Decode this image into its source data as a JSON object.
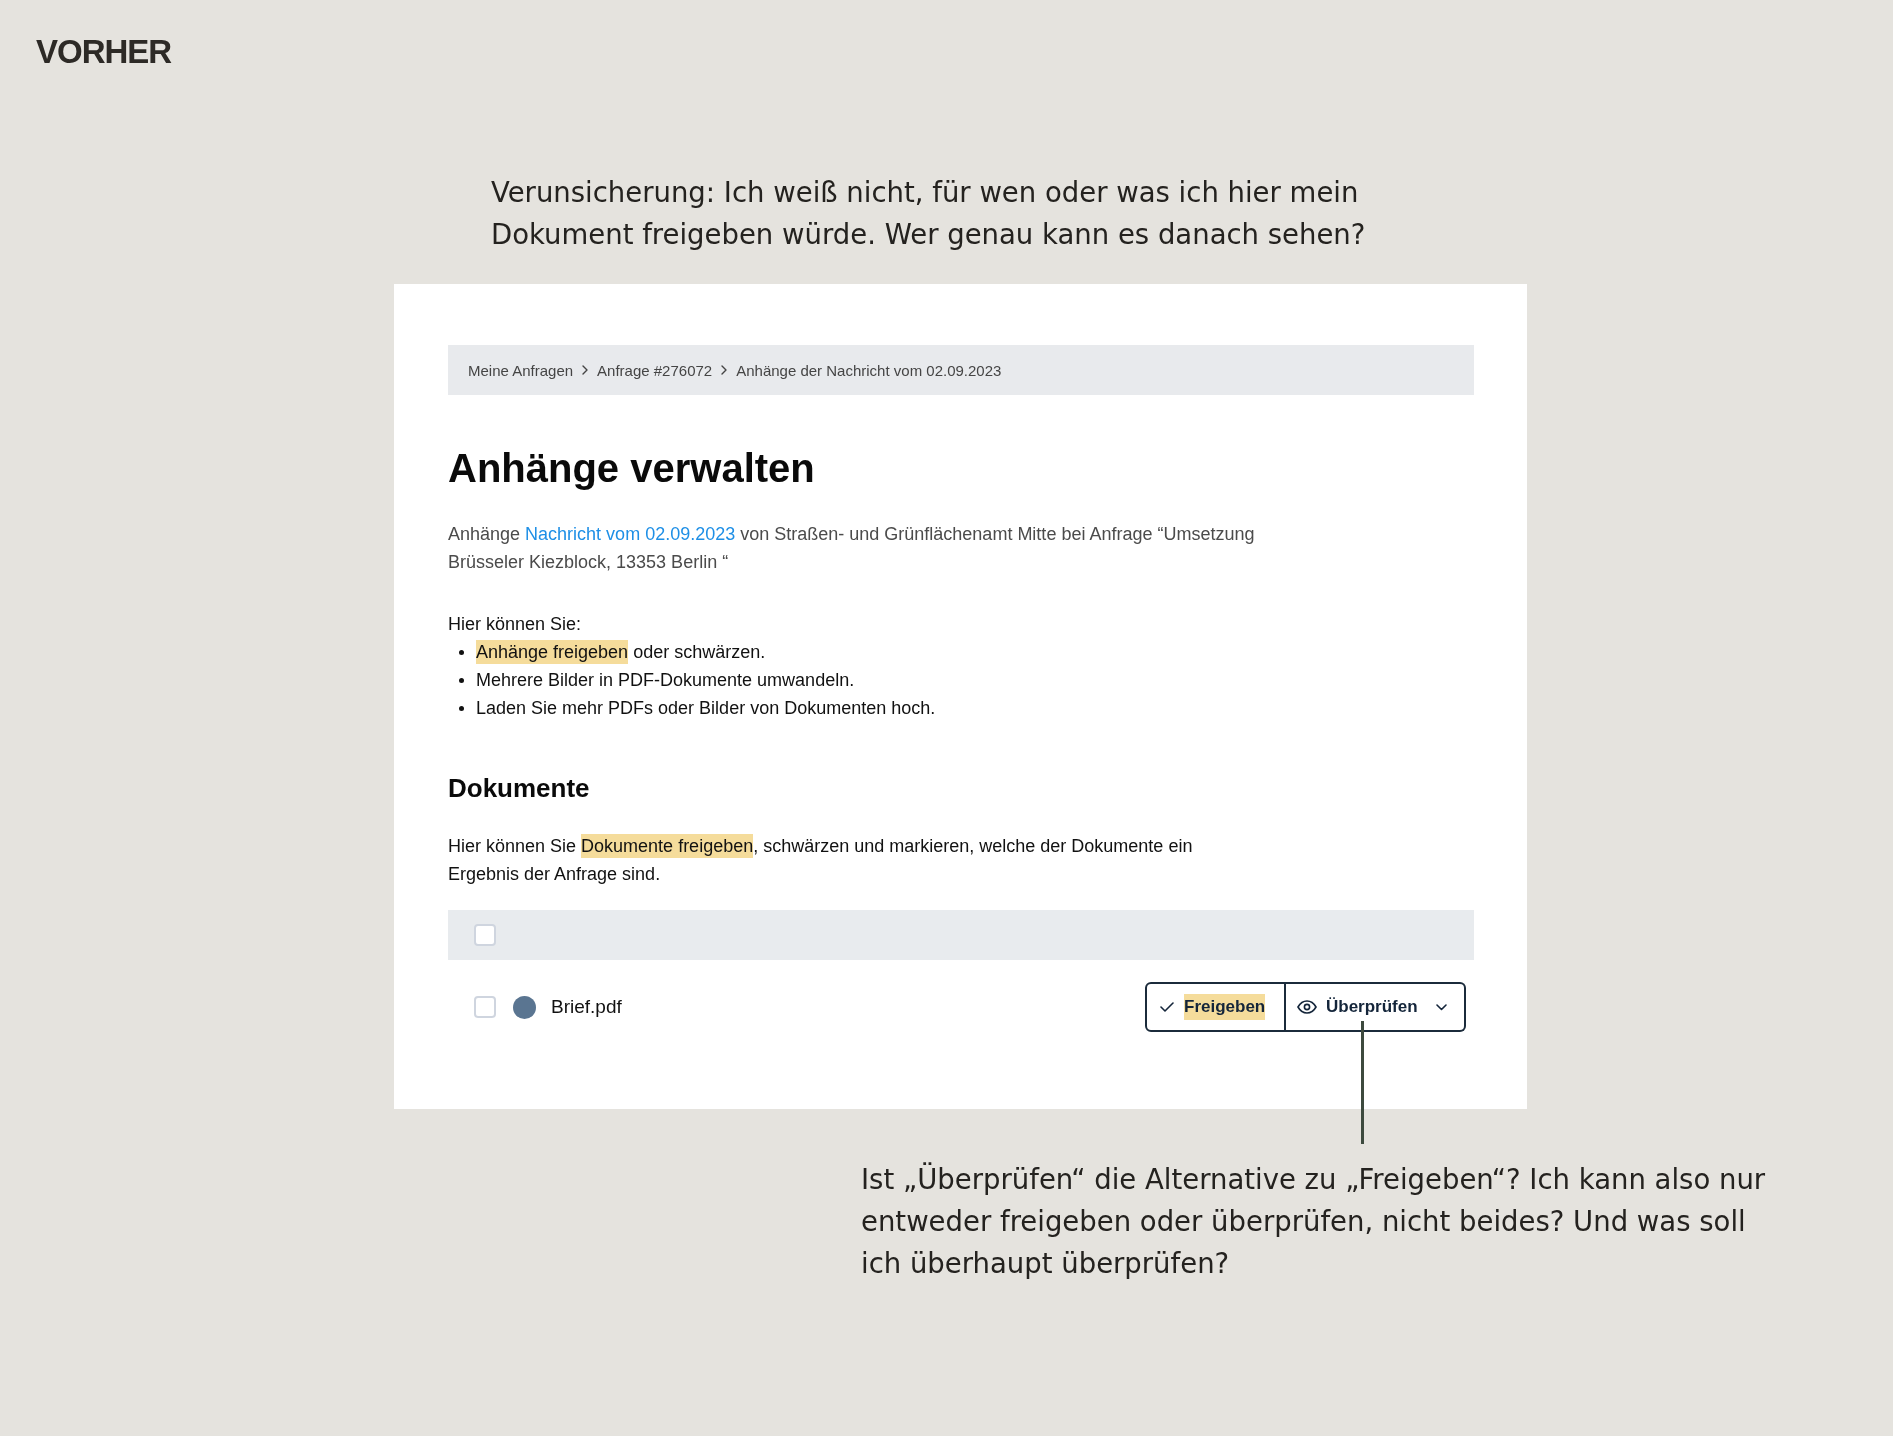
{
  "page_label": "VORHER",
  "intro_note": "Verunsicherung: Ich weiß nicht, für wen oder was ich hier mein Dokument freigeben würde. Wer genau kann es danach sehen?",
  "card": {
    "breadcrumb": [
      "Meine Anfragen",
      "Anfrage #276072",
      "Anhänge der Nachricht vom 02.09.2023"
    ],
    "title": "Anhänge verwalten",
    "intro": {
      "before": "Anhänge",
      "link": "Nachricht vom 02.09.2023",
      "after": "von Straßen- und Grünflächenamt Mitte bei Anfrage “Umsetzung Brüsseler Kiezblock, 13353 Berlin “"
    },
    "list_lead": "Hier können Sie:",
    "list_items": [
      {
        "segments": [
          {
            "text": "Anhänge freigeben",
            "highlighted": true
          },
          {
            "text": " oder schwärzen.",
            "highlighted": false
          }
        ]
      },
      {
        "segments": [
          {
            "text": "Mehrere Bilder in PDF-Dokumente umwandeln.",
            "highlighted": false
          }
        ]
      },
      {
        "segments": [
          {
            "text": "Laden Sie mehr PDFs oder Bilder von Dokumenten hoch.",
            "highlighted": false
          }
        ]
      }
    ],
    "section_title": "Dokumente",
    "section_text": [
      {
        "text": "Hier können Sie ",
        "highlighted": false
      },
      {
        "text": "Dokumente freigeben",
        "highlighted": true
      },
      {
        "text": ", schwärzen und markieren, welche der Dokumente ein Ergebnis der Anfrage sind.",
        "highlighted": false
      }
    ],
    "table": {
      "header": {
        "checked": false
      },
      "rows": [
        {
          "checked": false,
          "color": "#5a7591",
          "name": "Brief.pdf",
          "actions": [
            {
              "kind": "approve",
              "label": "Freigeben",
              "highlighted": true
            },
            {
              "kind": "review",
              "label": "Überprüfen",
              "highlighted": false
            }
          ]
        }
      ]
    }
  },
  "callout_note": "Ist „Überprüfen“ die Alternative zu „Freigeben“? Ich kann also nur entweder freigeben oder überprüfen, nicht beides? Und was soll ich überhaupt überprüfen?"
}
